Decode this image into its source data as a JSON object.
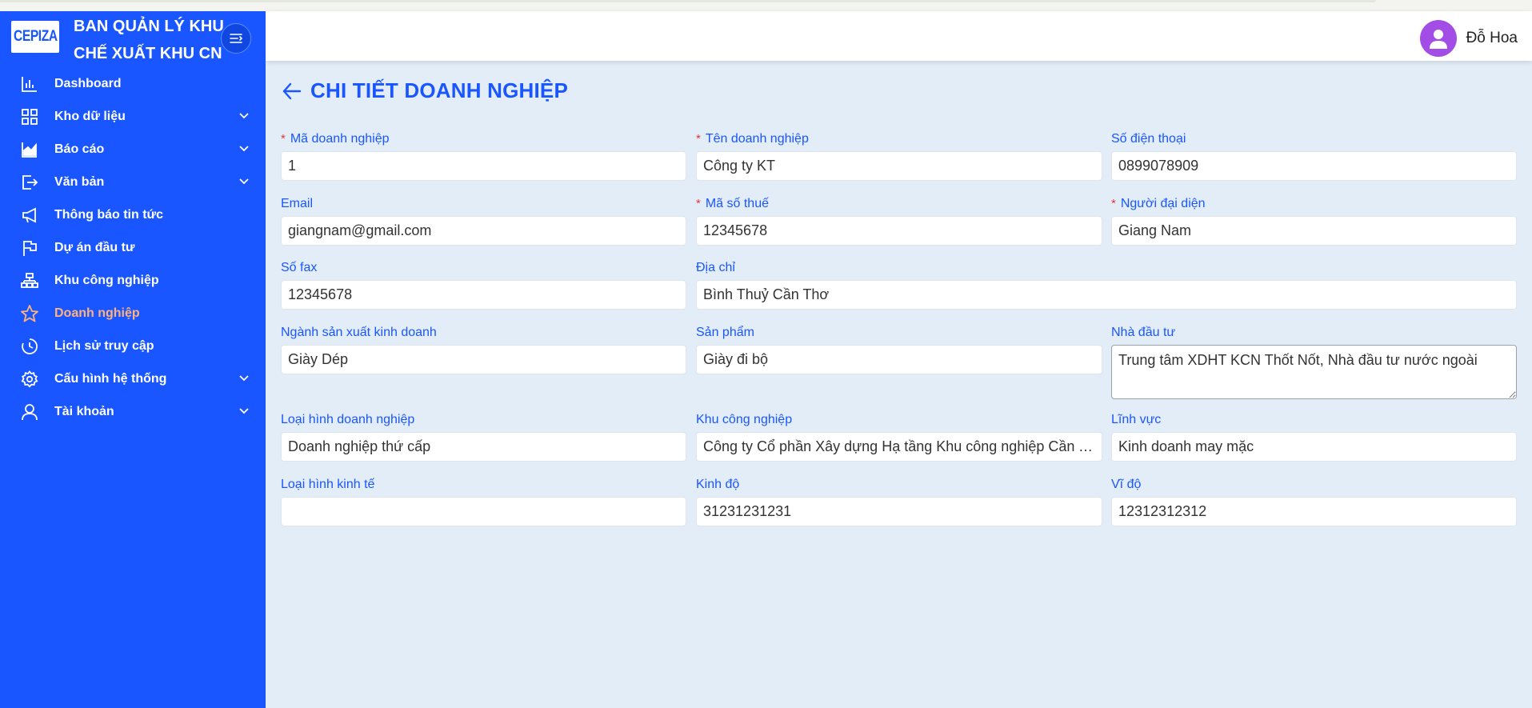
{
  "brand": {
    "logo_text": "CEPIZA",
    "title": "BAN QUẢN LÝ KHU CHẾ XUẤT KHU CN"
  },
  "sidebar": {
    "items": [
      {
        "label": "Dashboard",
        "icon": "bar-chart-icon",
        "has_submenu": false
      },
      {
        "label": "Kho dữ liệu",
        "icon": "grid-icon",
        "has_submenu": true
      },
      {
        "label": "Báo cáo",
        "icon": "area-chart-icon",
        "has_submenu": true
      },
      {
        "label": "Văn bản",
        "icon": "export-icon",
        "has_submenu": true
      },
      {
        "label": "Thông báo tin tức",
        "icon": "megaphone-icon",
        "has_submenu": false
      },
      {
        "label": "Dự án đầu tư",
        "icon": "flag-icon",
        "has_submenu": false
      },
      {
        "label": "Khu công nghiệp",
        "icon": "cluster-icon",
        "has_submenu": false
      },
      {
        "label": "Doanh nghiệp",
        "icon": "star-icon",
        "has_submenu": false,
        "active": true
      },
      {
        "label": "Lịch sử truy cập",
        "icon": "clock-icon",
        "has_submenu": false
      },
      {
        "label": "Cấu hình hệ thống",
        "icon": "gear-icon",
        "has_submenu": true
      },
      {
        "label": "Tài khoản",
        "icon": "user-icon",
        "has_submenu": true
      }
    ]
  },
  "header": {
    "user_name": "Đỗ Hoa"
  },
  "page": {
    "title": "CHI TIẾT DOANH NGHIỆP"
  },
  "form": {
    "ma_doanh_nghiep": {
      "label": "Mã doanh nghiệp",
      "value": "1",
      "required": true
    },
    "ten_doanh_nghiep": {
      "label": "Tên doanh nghiệp",
      "value": "Công ty KT",
      "required": true
    },
    "so_dien_thoai": {
      "label": "Số điện thoại",
      "value": "0899078909"
    },
    "email": {
      "label": "Email",
      "value": "giangnam@gmail.com"
    },
    "ma_so_thue": {
      "label": "Mã số thuế",
      "value": "12345678",
      "required": true
    },
    "nguoi_dai_dien": {
      "label": "Người đại diện",
      "value": "Giang Nam",
      "required": true
    },
    "so_fax": {
      "label": "Số fax",
      "value": "12345678"
    },
    "dia_chi": {
      "label": "Địa chỉ",
      "value": "Bình Thuỷ Cần Thơ"
    },
    "nganh_san_xuat": {
      "label": "Ngành sản xuất kinh doanh",
      "value": "Giày Dép"
    },
    "san_pham": {
      "label": "Sản phẩm",
      "value": "Giày đi bộ"
    },
    "nha_dau_tu": {
      "label": "Nhà đầu tư",
      "value": "Trung tâm XDHT KCN Thốt Nốt, Nhà đầu tư nước ngoài"
    },
    "loai_hinh_doanh_nghiep": {
      "label": "Loại hình doanh nghiệp",
      "value": "Doanh nghiệp thứ cấp"
    },
    "khu_cong_nghiep": {
      "label": "Khu công nghiệp",
      "value": "Công ty Cổ phần Xây dựng Hạ tầng Khu công nghiệp Cần Thơ"
    },
    "linh_vuc": {
      "label": "Lĩnh vực",
      "value": "Kinh doanh may mặc"
    },
    "loai_hinh_kinh_te": {
      "label": "Loại hình kinh tế",
      "value": ""
    },
    "kinh_do": {
      "label": "Kinh độ",
      "value": "31231231231"
    },
    "vi_do": {
      "label": "Vĩ độ",
      "value": "12312312312"
    }
  },
  "colors": {
    "sidebar_bg": "#1a56ff",
    "active_item": "#ffb27a",
    "accent": "#1a56ff",
    "content_bg": "#e3edf7",
    "required": "#e53935",
    "avatar": "#a24ee6"
  }
}
